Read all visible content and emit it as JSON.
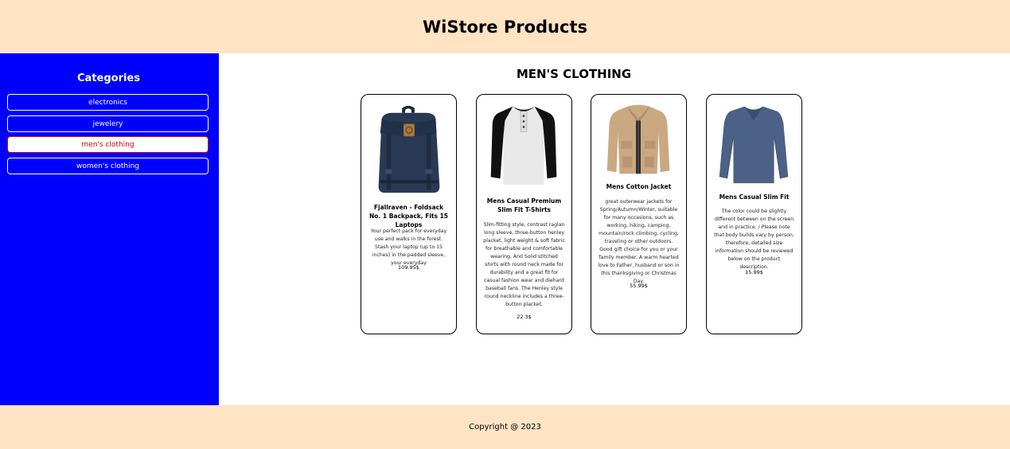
{
  "header": {
    "title": "WiStore Products"
  },
  "sidebar": {
    "title": "Categories",
    "categories": [
      {
        "label": "electronics",
        "active": false
      },
      {
        "label": "jewelery",
        "active": false
      },
      {
        "label": "men's clothing",
        "active": true
      },
      {
        "label": "women's clothing",
        "active": false
      }
    ]
  },
  "main": {
    "heading": "MEN'S CLOTHING",
    "products": [
      {
        "title": "Fjallraven - Foldsack No. 1 Backpack, Fits 15 Laptops",
        "description": "Your perfect pack for everyday use and walks in the forest. Stash your laptop (up to 15 inches) in the padded sleeve, your everyday",
        "price": "109.95$",
        "image_icon": "backpack-image"
      },
      {
        "title": "Mens Casual Premium Slim Fit T-Shirts",
        "description": "Slim-fitting style, contrast raglan long sleeve, three-button henley placket, light weight & soft fabric for breathable and comfortable wearing. And Solid stitched shirts with round neck made for durability and a great fit for casual fashion wear and diehard baseball fans. The Henley style round neckline includes a three-button placket.",
        "price": "22.3$",
        "image_icon": "henley-shirt-image"
      },
      {
        "title": "Mens Cotton Jacket",
        "description": "great outerwear jackets for Spring/Autumn/Winter, suitable for many occasions, such as working, hiking, camping, mountain/rock climbing, cycling, traveling or other outdoors. Good gift choice for you or your family member. A warm hearted love to Father, husband or son in this thanksgiving or Christmas Day.",
        "price": "55.99$",
        "image_icon": "cotton-jacket-image"
      },
      {
        "title": "Mens Casual Slim Fit",
        "description": "The color could be slightly different between on the screen and in practice. / Please note that body builds vary by person, therefore, detailed size information should be reviewed below on the product description.",
        "price": "15.99$",
        "image_icon": "slim-fit-shirt-image"
      }
    ]
  },
  "footer": {
    "text": "Copyright @ 2023"
  },
  "colors": {
    "header_bg": "#ffe4c4",
    "sidebar_bg": "#0000ff",
    "active_text": "#d00000"
  }
}
